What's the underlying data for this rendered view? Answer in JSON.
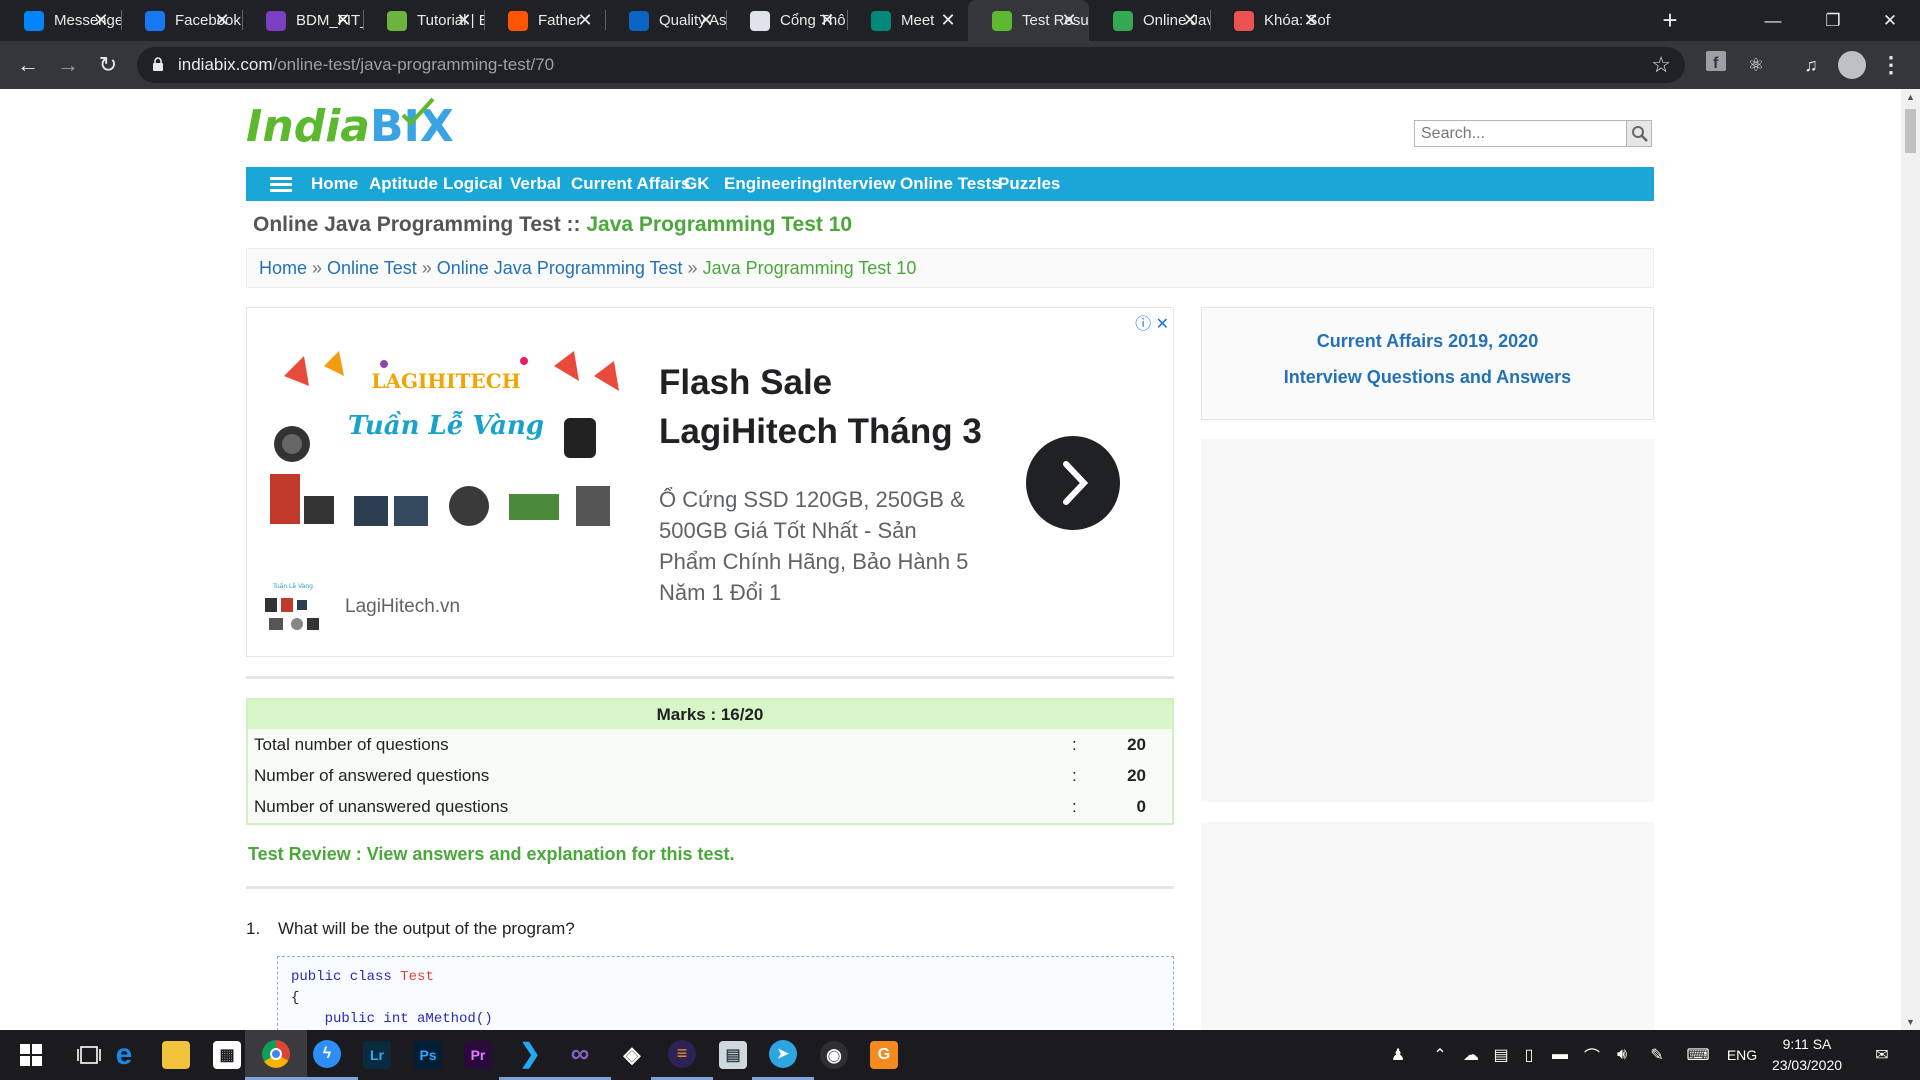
{
  "browser": {
    "tabs": [
      {
        "title": "Messenger",
        "icon": "messenger-icon",
        "color": "#0084ff"
      },
      {
        "title": "Facebook",
        "icon": "facebook-icon",
        "color": "#1877f2"
      },
      {
        "title": "BDM_FIT_",
        "icon": "teams-icon",
        "color": "#7b3fc4"
      },
      {
        "title": "Tutorial | E",
        "icon": "spring-icon",
        "color": "#6db33f"
      },
      {
        "title": "Father",
        "icon": "soundcloud-icon",
        "color": "#ff5500"
      },
      {
        "title": "Quality As",
        "icon": "linkedin-icon",
        "color": "#0a66c2"
      },
      {
        "title": "Cổng Thô",
        "icon": "portal-icon",
        "color": "#dfe3ea"
      },
      {
        "title": "Meet",
        "icon": "meet-icon",
        "color": "#00897b"
      },
      {
        "title": "Test Resul",
        "icon": "indiabix-icon",
        "color": "#5cb82e"
      },
      {
        "title": "Online Jav",
        "icon": "code-icon",
        "color": "#34a853"
      },
      {
        "title": "Khóa: Soft",
        "icon": "udemy-icon",
        "color": "#ec5252"
      }
    ],
    "url_host": "indiabix.com",
    "url_path": "/online-test/java-programming-test/70"
  },
  "site": {
    "logo_india": "India",
    "logo_bix": "BIX",
    "search_placeholder": "Search...",
    "nav": [
      "Home",
      "Aptitude",
      "Logical",
      "Verbal",
      "Current Affairs",
      "GK",
      "Engineering",
      "Interview",
      "Online Tests",
      "Puzzles"
    ],
    "title_main": "Online Java Programming Test",
    "title_sep": " :: ",
    "title_current": "Java Programming Test 10",
    "breadcrumb": [
      "Home",
      "Online Test",
      "Online Java Programming Test",
      "Java Programming Test 10"
    ],
    "breadcrumb_sep": " » "
  },
  "ad": {
    "headline": "Flash Sale\nLagiHitech Tháng 3",
    "description": "Ổ Cứng SSD 120GB, 250GB & 500GB Giá Tốt Nhất - Sản Phẩm Chính Hãng, Bảo Hành 5 Năm 1 Đổi 1",
    "site": "LagiHitech.vn",
    "banner_brand": "LAGIHITECH",
    "banner_slogan": "Tuần Lễ Vàng"
  },
  "result": {
    "marks": "Marks : 16/20",
    "rows": [
      {
        "label": "Total number of questions",
        "colon": ":",
        "value": "20"
      },
      {
        "label": "Number of answered questions",
        "colon": ":",
        "value": "20"
      },
      {
        "label": "Number of unanswered questions",
        "colon": ":",
        "value": "0"
      }
    ],
    "review": "Test Review : View answers and explanation for this test."
  },
  "question": {
    "number": "1.",
    "text": "What will be the output of the program?",
    "code_kw1": "public class",
    "code_cls": "Test",
    "code_brace": "{",
    "code_line3": "    public int aMethod()"
  },
  "sidebar": {
    "links": [
      "Current Affairs 2019, 2020",
      "Interview Questions and Answers"
    ]
  },
  "taskbar": {
    "apps": [
      "edge-icon",
      "file-explorer-icon",
      "store-icon",
      "chrome-icon",
      "messenger-icon",
      "lightroom-icon",
      "photoshop-icon",
      "premiere-icon",
      "vscode-icon",
      "visual-studio-icon",
      "unity-icon",
      "eclipse-icon",
      "scanner-icon",
      "telegram-icon",
      "obs-icon",
      "foxit-icon"
    ],
    "app_labels": {
      "lr": "Lr",
      "ps": "Ps",
      "pr": "Pr"
    },
    "language": "ENG",
    "time": "9:11 SA",
    "date": "23/03/2020"
  }
}
